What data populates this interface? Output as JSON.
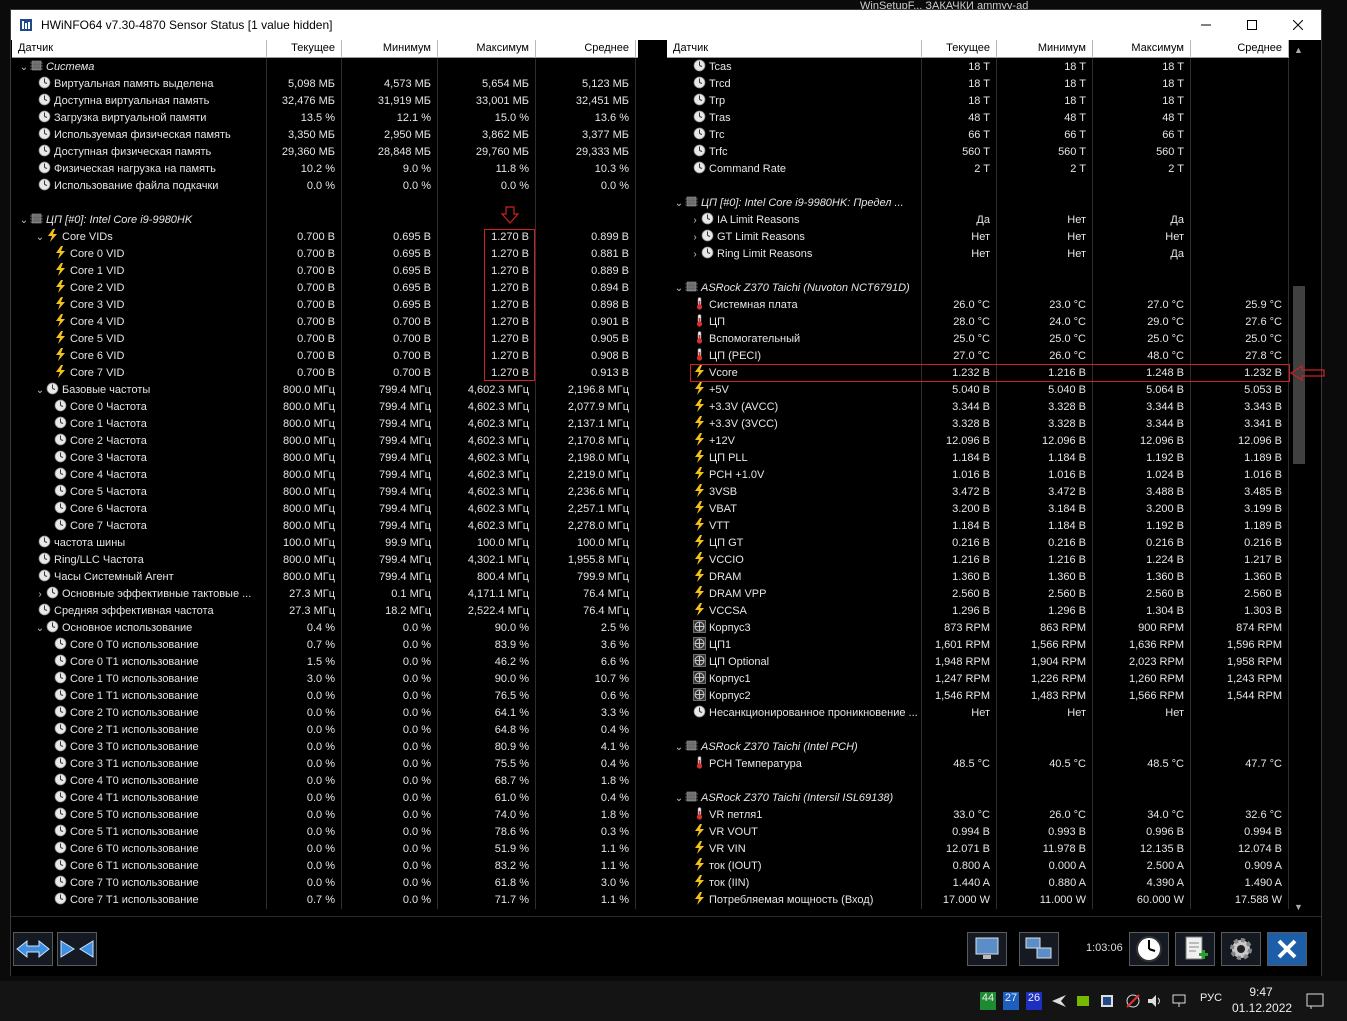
{
  "desktop": {
    "label": "WinSetupF...  ЗАКАЧКИ  ammyy-ad"
  },
  "window": {
    "title": "HWiNFO64 v7.30-4870 Sensor Status [1 value hidden]"
  },
  "columns": [
    "Датчик",
    "Текущее",
    "Минимум",
    "Максимум",
    "Среднее"
  ],
  "left_rows": [
    {
      "t": "g",
      "n": "Система",
      "l": 0,
      "ic": "chip"
    },
    {
      "n": "Виртуальная память выделена",
      "l": 1,
      "ic": "clock",
      "v": [
        "5,098 МБ",
        "4,573 МБ",
        "5,654 МБ",
        "5,123 МБ"
      ]
    },
    {
      "n": "Доступна виртуальная память",
      "l": 1,
      "ic": "clock",
      "v": [
        "32,476 МБ",
        "31,919 МБ",
        "33,001 МБ",
        "32,451 МБ"
      ]
    },
    {
      "n": "Загрузка виртуальной памяти",
      "l": 1,
      "ic": "clock",
      "v": [
        "13.5 %",
        "12.1 %",
        "15.0 %",
        "13.6 %"
      ]
    },
    {
      "n": "Используемая физическая память",
      "l": 1,
      "ic": "clock",
      "v": [
        "3,350 МБ",
        "2,950 МБ",
        "3,862 МБ",
        "3,377 МБ"
      ]
    },
    {
      "n": "Доступная физическая память",
      "l": 1,
      "ic": "clock",
      "v": [
        "29,360 МБ",
        "28,848 МБ",
        "29,760 МБ",
        "29,333 МБ"
      ]
    },
    {
      "n": "Физическая нагрузка на память",
      "l": 1,
      "ic": "clock",
      "v": [
        "10.2 %",
        "9.0 %",
        "11.8 %",
        "10.3 %"
      ]
    },
    {
      "n": "Использование файла подкачки",
      "l": 1,
      "ic": "clock",
      "v": [
        "0.0 %",
        "0.0 %",
        "0.0 %",
        "0.0 %"
      ]
    },
    {
      "t": "b"
    },
    {
      "t": "g",
      "n": "ЦП [#0]: Intel Core i9-9980HK",
      "l": 0,
      "ic": "chip"
    },
    {
      "n": "Core VIDs",
      "l": 2,
      "ic": "bolt",
      "e": "v",
      "v": [
        "0.700 В",
        "0.695 В",
        "1.270 В",
        "0.899 В"
      ]
    },
    {
      "n": "Core 0 VID",
      "l": 2,
      "ic": "bolt",
      "v": [
        "0.700 В",
        "0.695 В",
        "1.270 В",
        "0.881 В"
      ]
    },
    {
      "n": "Core 1 VID",
      "l": 2,
      "ic": "bolt",
      "v": [
        "0.700 В",
        "0.695 В",
        "1.270 В",
        "0.889 В"
      ]
    },
    {
      "n": "Core 2 VID",
      "l": 2,
      "ic": "bolt",
      "v": [
        "0.700 В",
        "0.695 В",
        "1.270 В",
        "0.894 В"
      ]
    },
    {
      "n": "Core 3 VID",
      "l": 2,
      "ic": "bolt",
      "v": [
        "0.700 В",
        "0.695 В",
        "1.270 В",
        "0.898 В"
      ]
    },
    {
      "n": "Core 4 VID",
      "l": 2,
      "ic": "bolt",
      "v": [
        "0.700 В",
        "0.700 В",
        "1.270 В",
        "0.901 В"
      ]
    },
    {
      "n": "Core 5 VID",
      "l": 2,
      "ic": "bolt",
      "v": [
        "0.700 В",
        "0.700 В",
        "1.270 В",
        "0.905 В"
      ]
    },
    {
      "n": "Core 6 VID",
      "l": 2,
      "ic": "bolt",
      "v": [
        "0.700 В",
        "0.700 В",
        "1.270 В",
        "0.908 В"
      ]
    },
    {
      "n": "Core 7 VID",
      "l": 2,
      "ic": "bolt",
      "v": [
        "0.700 В",
        "0.700 В",
        "1.270 В",
        "0.913 В"
      ]
    },
    {
      "n": "Базовые частоты",
      "l": 2,
      "ic": "clock",
      "e": "v",
      "v": [
        "800.0 МГц",
        "799.4 МГц",
        "4,602.3 МГц",
        "2,196.8 МГц"
      ]
    },
    {
      "n": "Core 0 Частота",
      "l": 2,
      "ic": "clock",
      "v": [
        "800.0 МГц",
        "799.4 МГц",
        "4,602.3 МГц",
        "2,077.9 МГц"
      ]
    },
    {
      "n": "Core 1 Частота",
      "l": 2,
      "ic": "clock",
      "v": [
        "800.0 МГц",
        "799.4 МГц",
        "4,602.3 МГц",
        "2,137.1 МГц"
      ]
    },
    {
      "n": "Core 2 Частота",
      "l": 2,
      "ic": "clock",
      "v": [
        "800.0 МГц",
        "799.4 МГц",
        "4,602.3 МГц",
        "2,170.8 МГц"
      ]
    },
    {
      "n": "Core 3 Частота",
      "l": 2,
      "ic": "clock",
      "v": [
        "800.0 МГц",
        "799.4 МГц",
        "4,602.3 МГц",
        "2,198.0 МГц"
      ]
    },
    {
      "n": "Core 4 Частота",
      "l": 2,
      "ic": "clock",
      "v": [
        "800.0 МГц",
        "799.4 МГц",
        "4,602.3 МГц",
        "2,219.0 МГц"
      ]
    },
    {
      "n": "Core 5 Частота",
      "l": 2,
      "ic": "clock",
      "v": [
        "800.0 МГц",
        "799.4 МГц",
        "4,602.3 МГц",
        "2,236.6 МГц"
      ]
    },
    {
      "n": "Core 6 Частота",
      "l": 2,
      "ic": "clock",
      "v": [
        "800.0 МГц",
        "799.4 МГц",
        "4,602.3 МГц",
        "2,257.1 МГц"
      ]
    },
    {
      "n": "Core 7 Частота",
      "l": 2,
      "ic": "clock",
      "v": [
        "800.0 МГц",
        "799.4 МГц",
        "4,602.3 МГц",
        "2,278.0 МГц"
      ]
    },
    {
      "n": "частота шины",
      "l": 1,
      "ic": "clock",
      "v": [
        "100.0 МГц",
        "99.9 МГц",
        "100.0 МГц",
        "100.0 МГц"
      ]
    },
    {
      "n": "Ring/LLC Частота",
      "l": 1,
      "ic": "clock",
      "v": [
        "800.0 МГц",
        "799.4 МГц",
        "4,302.1 МГц",
        "1,955.8 МГц"
      ]
    },
    {
      "n": "Часы Системный Агент",
      "l": 1,
      "ic": "clock",
      "v": [
        "800.0 МГц",
        "799.4 МГц",
        "800.4 МГц",
        "799.9 МГц"
      ]
    },
    {
      "n": "Основные эффективные тактовые ...",
      "l": 2,
      "ic": "clock",
      "e": ">",
      "v": [
        "27.3 МГц",
        "0.1 МГц",
        "4,171.1 МГц",
        "76.4 МГц"
      ]
    },
    {
      "n": "Средняя эффективная частота",
      "l": 1,
      "ic": "clock",
      "v": [
        "27.3 МГц",
        "18.2 МГц",
        "2,522.4 МГц",
        "76.4 МГц"
      ]
    },
    {
      "n": "Основное использование",
      "l": 2,
      "ic": "clock",
      "e": "v",
      "v": [
        "0.4 %",
        "0.0 %",
        "90.0 %",
        "2.5 %"
      ]
    },
    {
      "n": "Core 0 T0 использование",
      "l": 2,
      "ic": "clock",
      "v": [
        "0.7 %",
        "0.0 %",
        "83.9 %",
        "3.6 %"
      ]
    },
    {
      "n": "Core 0 T1 использование",
      "l": 2,
      "ic": "clock",
      "v": [
        "1.5 %",
        "0.0 %",
        "46.2 %",
        "6.6 %"
      ]
    },
    {
      "n": "Core 1 T0 использование",
      "l": 2,
      "ic": "clock",
      "v": [
        "3.0 %",
        "0.0 %",
        "90.0 %",
        "10.7 %"
      ]
    },
    {
      "n": "Core 1 T1 использование",
      "l": 2,
      "ic": "clock",
      "v": [
        "0.0 %",
        "0.0 %",
        "76.5 %",
        "0.6 %"
      ]
    },
    {
      "n": "Core 2 T0 использование",
      "l": 2,
      "ic": "clock",
      "v": [
        "0.0 %",
        "0.0 %",
        "64.1 %",
        "3.3 %"
      ]
    },
    {
      "n": "Core 2 T1 использование",
      "l": 2,
      "ic": "clock",
      "v": [
        "0.0 %",
        "0.0 %",
        "64.8 %",
        "0.4 %"
      ]
    },
    {
      "n": "Core 3 T0 использование",
      "l": 2,
      "ic": "clock",
      "v": [
        "0.0 %",
        "0.0 %",
        "80.9 %",
        "4.1 %"
      ]
    },
    {
      "n": "Core 3 T1 использование",
      "l": 2,
      "ic": "clock",
      "v": [
        "0.0 %",
        "0.0 %",
        "75.5 %",
        "0.4 %"
      ]
    },
    {
      "n": "Core 4 T0 использование",
      "l": 2,
      "ic": "clock",
      "v": [
        "0.0 %",
        "0.0 %",
        "68.7 %",
        "1.8 %"
      ]
    },
    {
      "n": "Core 4 T1 использование",
      "l": 2,
      "ic": "clock",
      "v": [
        "0.0 %",
        "0.0 %",
        "61.0 %",
        "0.4 %"
      ]
    },
    {
      "n": "Core 5 T0 использование",
      "l": 2,
      "ic": "clock",
      "v": [
        "0.0 %",
        "0.0 %",
        "74.0 %",
        "1.8 %"
      ]
    },
    {
      "n": "Core 5 T1 использование",
      "l": 2,
      "ic": "clock",
      "v": [
        "0.0 %",
        "0.0 %",
        "78.6 %",
        "0.3 %"
      ]
    },
    {
      "n": "Core 6 T0 использование",
      "l": 2,
      "ic": "clock",
      "v": [
        "0.0 %",
        "0.0 %",
        "51.9 %",
        "1.1 %"
      ]
    },
    {
      "n": "Core 6 T1 использование",
      "l": 2,
      "ic": "clock",
      "v": [
        "0.0 %",
        "0.0 %",
        "83.2 %",
        "1.1 %"
      ]
    },
    {
      "n": "Core 7 T0 использование",
      "l": 2,
      "ic": "clock",
      "v": [
        "0.0 %",
        "0.0 %",
        "61.8 %",
        "3.0 %"
      ]
    },
    {
      "n": "Core 7 T1 использование",
      "l": 2,
      "ic": "clock",
      "v": [
        "0.7 %",
        "0.0 %",
        "71.7 %",
        "1.1 %"
      ]
    }
  ],
  "right_rows": [
    {
      "n": "Tcas",
      "l": 1,
      "ic": "clock",
      "v": [
        "18 T",
        "18 T",
        "18 T",
        ""
      ]
    },
    {
      "n": "Trcd",
      "l": 1,
      "ic": "clock",
      "v": [
        "18 T",
        "18 T",
        "18 T",
        ""
      ]
    },
    {
      "n": "Trp",
      "l": 1,
      "ic": "clock",
      "v": [
        "18 T",
        "18 T",
        "18 T",
        ""
      ]
    },
    {
      "n": "Tras",
      "l": 1,
      "ic": "clock",
      "v": [
        "48 T",
        "48 T",
        "48 T",
        ""
      ]
    },
    {
      "n": "Trc",
      "l": 1,
      "ic": "clock",
      "v": [
        "66 T",
        "66 T",
        "66 T",
        ""
      ]
    },
    {
      "n": "Trfc",
      "l": 1,
      "ic": "clock",
      "v": [
        "560 T",
        "560 T",
        "560 T",
        ""
      ]
    },
    {
      "n": "Command Rate",
      "l": 1,
      "ic": "clock",
      "v": [
        "2 T",
        "2 T",
        "2 T",
        ""
      ]
    },
    {
      "t": "b"
    },
    {
      "t": "g",
      "n": "ЦП [#0]: Intel Core i9-9980HK: Предел ...",
      "l": 0,
      "ic": "chip"
    },
    {
      "n": "IA Limit Reasons",
      "l": 2,
      "ic": "clock",
      "e": ">",
      "v": [
        "Да",
        "Нет",
        "Да",
        ""
      ]
    },
    {
      "n": "GT Limit Reasons",
      "l": 2,
      "ic": "clock",
      "e": ">",
      "v": [
        "Нет",
        "Нет",
        "Нет",
        ""
      ]
    },
    {
      "n": "Ring Limit Reasons",
      "l": 2,
      "ic": "clock",
      "e": ">",
      "v": [
        "Нет",
        "Нет",
        "Да",
        ""
      ]
    },
    {
      "t": "b"
    },
    {
      "t": "g",
      "n": "ASRock Z370 Taichi (Nuvoton NCT6791D)",
      "l": 0,
      "ic": "chip"
    },
    {
      "n": "Системная плата",
      "l": 1,
      "ic": "temp",
      "v": [
        "26.0 °C",
        "23.0 °C",
        "27.0 °C",
        "25.9 °C"
      ]
    },
    {
      "n": "ЦП",
      "l": 1,
      "ic": "temp",
      "v": [
        "28.0 °C",
        "24.0 °C",
        "29.0 °C",
        "27.6 °C"
      ]
    },
    {
      "n": "Вспомогательный",
      "l": 1,
      "ic": "temp",
      "v": [
        "25.0 °C",
        "25.0 °C",
        "25.0 °C",
        "25.0 °C"
      ]
    },
    {
      "n": "ЦП (PECI)",
      "l": 1,
      "ic": "temp",
      "v": [
        "27.0 °C",
        "26.0 °C",
        "48.0 °C",
        "27.8 °C"
      ]
    },
    {
      "n": "Vcore",
      "l": 1,
      "ic": "bolt",
      "v": [
        "1.232 В",
        "1.216 В",
        "1.248 В",
        "1.232 В"
      ]
    },
    {
      "n": "+5V",
      "l": 1,
      "ic": "bolt",
      "v": [
        "5.040 В",
        "5.040 В",
        "5.064 В",
        "5.053 В"
      ]
    },
    {
      "n": "+3.3V (AVCC)",
      "l": 1,
      "ic": "bolt",
      "v": [
        "3.344 В",
        "3.328 В",
        "3.344 В",
        "3.343 В"
      ]
    },
    {
      "n": "+3.3V (3VCC)",
      "l": 1,
      "ic": "bolt",
      "v": [
        "3.328 В",
        "3.328 В",
        "3.344 В",
        "3.341 В"
      ]
    },
    {
      "n": "+12V",
      "l": 1,
      "ic": "bolt",
      "v": [
        "12.096 В",
        "12.096 В",
        "12.096 В",
        "12.096 В"
      ]
    },
    {
      "n": "ЦП PLL",
      "l": 1,
      "ic": "bolt",
      "v": [
        "1.184 В",
        "1.184 В",
        "1.192 В",
        "1.189 В"
      ]
    },
    {
      "n": "PCH +1.0V",
      "l": 1,
      "ic": "bolt",
      "v": [
        "1.016 В",
        "1.016 В",
        "1.024 В",
        "1.016 В"
      ]
    },
    {
      "n": "3VSB",
      "l": 1,
      "ic": "bolt",
      "v": [
        "3.472 В",
        "3.472 В",
        "3.488 В",
        "3.485 В"
      ]
    },
    {
      "n": "VBAT",
      "l": 1,
      "ic": "bolt",
      "v": [
        "3.200 В",
        "3.184 В",
        "3.200 В",
        "3.199 В"
      ]
    },
    {
      "n": "VTT",
      "l": 1,
      "ic": "bolt",
      "v": [
        "1.184 В",
        "1.184 В",
        "1.192 В",
        "1.189 В"
      ]
    },
    {
      "n": "ЦП GT",
      "l": 1,
      "ic": "bolt",
      "v": [
        "0.216 В",
        "0.216 В",
        "0.216 В",
        "0.216 В"
      ]
    },
    {
      "n": "VCCIO",
      "l": 1,
      "ic": "bolt",
      "v": [
        "1.216 В",
        "1.216 В",
        "1.224 В",
        "1.217 В"
      ]
    },
    {
      "n": "DRAM",
      "l": 1,
      "ic": "bolt",
      "v": [
        "1.360 В",
        "1.360 В",
        "1.360 В",
        "1.360 В"
      ]
    },
    {
      "n": "DRAM VPP",
      "l": 1,
      "ic": "bolt",
      "v": [
        "2.560 В",
        "2.560 В",
        "2.560 В",
        "2.560 В"
      ]
    },
    {
      "n": "VCCSA",
      "l": 1,
      "ic": "bolt",
      "v": [
        "1.296 В",
        "1.296 В",
        "1.304 В",
        "1.303 В"
      ]
    },
    {
      "n": "Корпус3",
      "l": 1,
      "ic": "fan",
      "v": [
        "873 RPM",
        "863 RPM",
        "900 RPM",
        "874 RPM"
      ]
    },
    {
      "n": "ЦП1",
      "l": 1,
      "ic": "fan",
      "v": [
        "1,601 RPM",
        "1,566 RPM",
        "1,636 RPM",
        "1,596 RPM"
      ]
    },
    {
      "n": "ЦП Optional",
      "l": 1,
      "ic": "fan",
      "v": [
        "1,948 RPM",
        "1,904 RPM",
        "2,023 RPM",
        "1,958 RPM"
      ]
    },
    {
      "n": "Корпус1",
      "l": 1,
      "ic": "fan",
      "v": [
        "1,247 RPM",
        "1,226 RPM",
        "1,260 RPM",
        "1,243 RPM"
      ]
    },
    {
      "n": "Корпус2",
      "l": 1,
      "ic": "fan",
      "v": [
        "1,546 RPM",
        "1,483 RPM",
        "1,566 RPM",
        "1,544 RPM"
      ]
    },
    {
      "n": "Несанкционированное проникновение ...",
      "l": 1,
      "ic": "clock",
      "v": [
        "Нет",
        "Нет",
        "Нет",
        ""
      ]
    },
    {
      "t": "b"
    },
    {
      "t": "g",
      "n": "ASRock Z370 Taichi (Intel PCH)",
      "l": 0,
      "ic": "chip"
    },
    {
      "n": "PCH Температура",
      "l": 1,
      "ic": "temp",
      "v": [
        "48.5 °C",
        "40.5 °C",
        "48.5 °C",
        "47.7 °C"
      ]
    },
    {
      "t": "b"
    },
    {
      "t": "g",
      "n": "ASRock Z370 Taichi (Intersil ISL69138)",
      "l": 0,
      "ic": "chip"
    },
    {
      "n": "VR петля1",
      "l": 1,
      "ic": "temp",
      "v": [
        "33.0 °C",
        "26.0 °C",
        "34.0 °C",
        "32.6 °C"
      ]
    },
    {
      "n": "VR VOUT",
      "l": 1,
      "ic": "bolt",
      "v": [
        "0.994 В",
        "0.993 В",
        "0.996 В",
        "0.994 В"
      ]
    },
    {
      "n": "VR VIN",
      "l": 1,
      "ic": "bolt",
      "v": [
        "12.071 В",
        "11.978 В",
        "12.135 В",
        "12.074 В"
      ]
    },
    {
      "n": "ток (IOUT)",
      "l": 1,
      "ic": "bolt",
      "v": [
        "0.800 A",
        "0.000 A",
        "2.500 A",
        "0.909 A"
      ]
    },
    {
      "n": "ток (IIN)",
      "l": 1,
      "ic": "bolt",
      "v": [
        "1.440 A",
        "0.880 A",
        "4.390 A",
        "1.490 A"
      ]
    },
    {
      "n": "Потребляемая мощность (Вход)",
      "l": 1,
      "ic": "bolt",
      "v": [
        "17.000 W",
        "11.000 W",
        "60.000 W",
        "17.588 W"
      ]
    }
  ],
  "bottom": {
    "timer": "1:03:06"
  },
  "taskbar": {
    "badge1": "44",
    "badge2": "27",
    "badge3": "26",
    "lang": "РУС",
    "time": "9:47",
    "date": "01.12.2022"
  },
  "colors": {
    "accent_red": "#d02020",
    "bolt": "#f2c21a"
  }
}
